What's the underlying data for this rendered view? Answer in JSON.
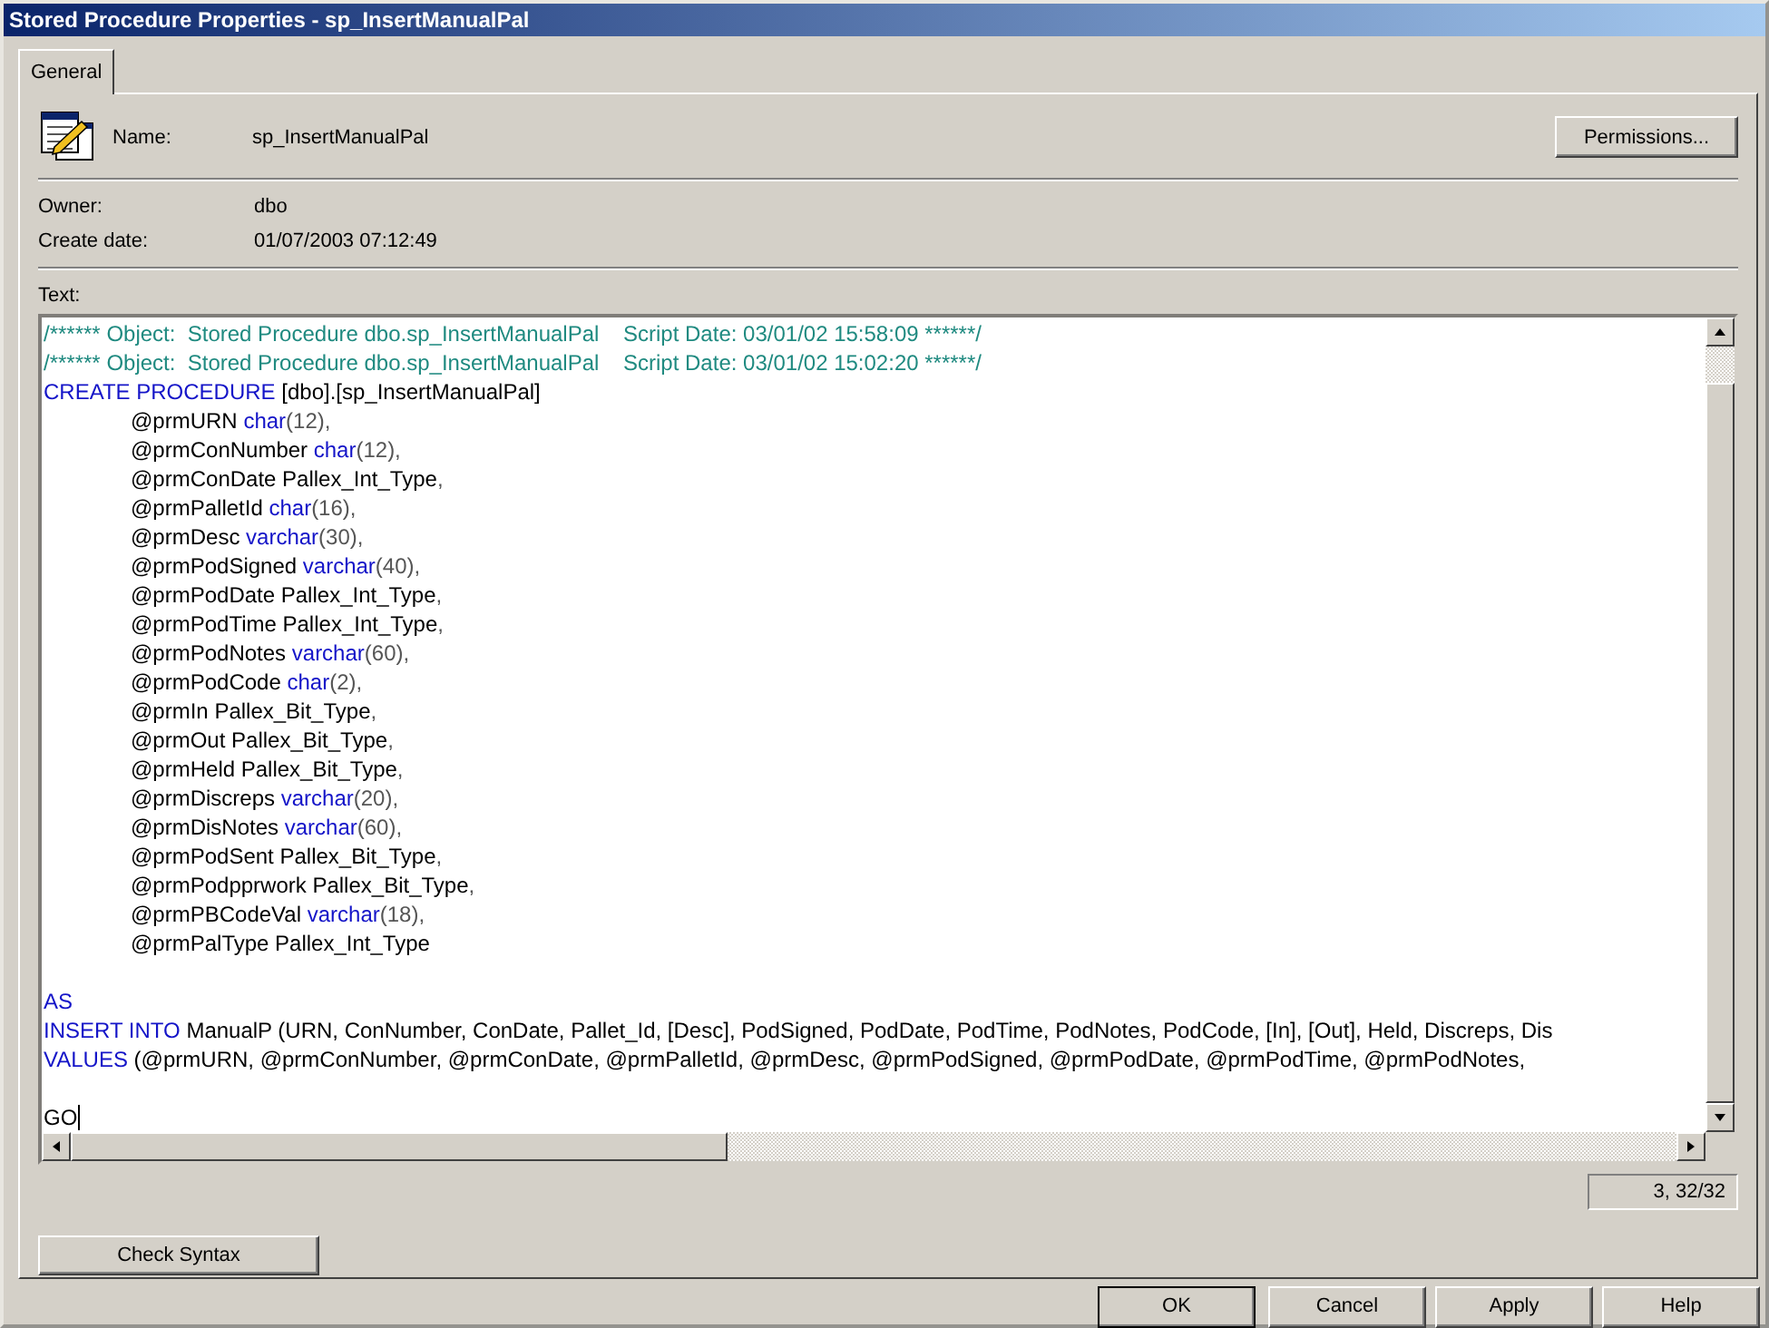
{
  "window": {
    "title": "Stored Procedure Properties - sp_InsertManualPal"
  },
  "tabs": [
    {
      "label": "General",
      "selected": true
    }
  ],
  "properties": {
    "name_label": "Name:",
    "name": "sp_InsertManualPal",
    "owner_label": "Owner:",
    "owner": "dbo",
    "create_date_label": "Create date:",
    "create_date": "01/07/2003 07:12:49"
  },
  "permissions_button": "Permissions...",
  "text_label": "Text:",
  "editor": {
    "lines": [
      {
        "kind": "statement",
        "segments": [
          {
            "kind": "comment",
            "text": "/****** Object:  Stored Procedure dbo.sp_InsertManualPal    Script Date: 03/01/02 15:58:09 ******/"
          }
        ]
      },
      {
        "kind": "statement",
        "segments": [
          {
            "kind": "comment",
            "text": "/****** Object:  Stored Procedure dbo.sp_InsertManualPal    Script Date: 03/01/02 15:02:20 ******/"
          }
        ]
      },
      {
        "kind": "statement",
        "segments": [
          {
            "kind": "keyword",
            "text": "CREATE PROCEDURE"
          },
          {
            "kind": "plain",
            "text": " [dbo].[sp_InsertManualPal]"
          }
        ]
      },
      {
        "kind": "param",
        "segments": [
          {
            "kind": "plain",
            "text": "@prmURN "
          },
          {
            "kind": "keyword",
            "text": "char"
          },
          {
            "kind": "punct",
            "text": "(12),"
          }
        ]
      },
      {
        "kind": "param",
        "segments": [
          {
            "kind": "plain",
            "text": "@prmConNumber "
          },
          {
            "kind": "keyword",
            "text": "char"
          },
          {
            "kind": "punct",
            "text": "(12),"
          }
        ]
      },
      {
        "kind": "param",
        "segments": [
          {
            "kind": "plain",
            "text": "@prmConDate Pallex_Int_Type"
          },
          {
            "kind": "punct",
            "text": ","
          }
        ]
      },
      {
        "kind": "param",
        "segments": [
          {
            "kind": "plain",
            "text": "@prmPalletId "
          },
          {
            "kind": "keyword",
            "text": "char"
          },
          {
            "kind": "punct",
            "text": "(16),"
          }
        ]
      },
      {
        "kind": "param",
        "segments": [
          {
            "kind": "plain",
            "text": "@prmDesc "
          },
          {
            "kind": "keyword",
            "text": "varchar"
          },
          {
            "kind": "punct",
            "text": "(30),"
          }
        ]
      },
      {
        "kind": "param",
        "segments": [
          {
            "kind": "plain",
            "text": "@prmPodSigned "
          },
          {
            "kind": "keyword",
            "text": "varchar"
          },
          {
            "kind": "punct",
            "text": "(40),"
          }
        ]
      },
      {
        "kind": "param",
        "segments": [
          {
            "kind": "plain",
            "text": "@prmPodDate Pallex_Int_Type"
          },
          {
            "kind": "punct",
            "text": ","
          }
        ]
      },
      {
        "kind": "param",
        "segments": [
          {
            "kind": "plain",
            "text": "@prmPodTime Pallex_Int_Type"
          },
          {
            "kind": "punct",
            "text": ","
          }
        ]
      },
      {
        "kind": "param",
        "segments": [
          {
            "kind": "plain",
            "text": "@prmPodNotes "
          },
          {
            "kind": "keyword",
            "text": "varchar"
          },
          {
            "kind": "punct",
            "text": "(60),"
          }
        ]
      },
      {
        "kind": "param",
        "segments": [
          {
            "kind": "plain",
            "text": "@prmPodCode "
          },
          {
            "kind": "keyword",
            "text": "char"
          },
          {
            "kind": "punct",
            "text": "(2),"
          }
        ]
      },
      {
        "kind": "param",
        "segments": [
          {
            "kind": "plain",
            "text": "@prmIn Pallex_Bit_Type"
          },
          {
            "kind": "punct",
            "text": ","
          }
        ]
      },
      {
        "kind": "param",
        "segments": [
          {
            "kind": "plain",
            "text": "@prmOut Pallex_Bit_Type"
          },
          {
            "kind": "punct",
            "text": ","
          }
        ]
      },
      {
        "kind": "param",
        "segments": [
          {
            "kind": "plain",
            "text": "@prmHeld Pallex_Bit_Type"
          },
          {
            "kind": "punct",
            "text": ","
          }
        ]
      },
      {
        "kind": "param",
        "segments": [
          {
            "kind": "plain",
            "text": "@prmDiscreps "
          },
          {
            "kind": "keyword",
            "text": "varchar"
          },
          {
            "kind": "punct",
            "text": "(20),"
          }
        ]
      },
      {
        "kind": "param",
        "segments": [
          {
            "kind": "plain",
            "text": "@prmDisNotes "
          },
          {
            "kind": "keyword",
            "text": "varchar"
          },
          {
            "kind": "punct",
            "text": "(60),"
          }
        ]
      },
      {
        "kind": "param",
        "segments": [
          {
            "kind": "plain",
            "text": "@prmPodSent Pallex_Bit_Type"
          },
          {
            "kind": "punct",
            "text": ","
          }
        ]
      },
      {
        "kind": "param",
        "segments": [
          {
            "kind": "plain",
            "text": "@prmPodpprwork Pallex_Bit_Type"
          },
          {
            "kind": "punct",
            "text": ","
          }
        ]
      },
      {
        "kind": "param",
        "segments": [
          {
            "kind": "plain",
            "text": "@prmPBCodeVal "
          },
          {
            "kind": "keyword",
            "text": "varchar"
          },
          {
            "kind": "punct",
            "text": "(18),"
          }
        ]
      },
      {
        "kind": "param",
        "segments": [
          {
            "kind": "plain",
            "text": "@prmPalType Pallex_Int_Type"
          }
        ]
      },
      {
        "kind": "blank"
      },
      {
        "kind": "statement",
        "segments": [
          {
            "kind": "keyword",
            "text": "AS"
          }
        ]
      },
      {
        "kind": "statement",
        "segments": [
          {
            "kind": "keyword",
            "text": "INSERT INTO"
          },
          {
            "kind": "plain",
            "text": " ManualP (URN, ConNumber, ConDate, Pallet_Id, [Desc], PodSigned, PodDate, PodTime, PodNotes, PodCode, [In], [Out], Held, Discreps, Dis"
          }
        ]
      },
      {
        "kind": "statement",
        "segments": [
          {
            "kind": "keyword",
            "text": "VALUES"
          },
          {
            "kind": "plain",
            "text": " (@prmURN, @prmConNumber, @prmConDate, @prmPalletId, @prmDesc, @prmPodSigned, @prmPodDate, @prmPodTime, @prmPodNotes,"
          }
        ]
      },
      {
        "kind": "blank"
      },
      {
        "kind": "statement",
        "cursor": true,
        "segments": [
          {
            "kind": "plain",
            "text": "GO"
          }
        ]
      }
    ]
  },
  "cursor_position": "3, 32/32",
  "check_syntax_button": "Check Syntax",
  "buttons": [
    "OK",
    "Cancel",
    "Apply",
    "Help"
  ]
}
